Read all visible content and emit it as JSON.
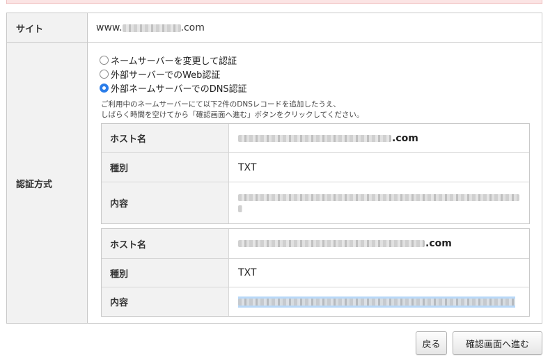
{
  "site_row": {
    "label": "サイト",
    "prefix": "www.",
    "suffix": ".com"
  },
  "auth_row": {
    "label": "認証方式",
    "options": [
      {
        "label": "ネームサーバーを変更して認証",
        "checked": false
      },
      {
        "label": "外部サーバーでのWeb認証",
        "checked": false
      },
      {
        "label": "外部ネームサーバーでのDNS認証",
        "checked": true
      }
    ],
    "note_line1": "ご利用中のネームサーバーにて以下2件のDNSレコードを追加したうえ、",
    "note_line2": "しばらく時間を空けてから「確認画面へ進む」ボタンをクリックしてください。"
  },
  "records": [
    {
      "host_label": "ホスト名",
      "host_suffix": ".com",
      "type_label": "種別",
      "type_value": "TXT",
      "content_label": "内容"
    },
    {
      "host_label": "ホスト名",
      "host_suffix": ".com",
      "type_label": "種別",
      "type_value": "TXT",
      "content_label": "内容"
    }
  ],
  "buttons": {
    "back": "戻る",
    "confirm": "確認画面へ進む"
  },
  "colors": {
    "header_bg": "#f2f2f2",
    "border": "#c9c9c9",
    "radio_checked": "#2b7de9",
    "selection_highlight": "#b8d8f8"
  }
}
